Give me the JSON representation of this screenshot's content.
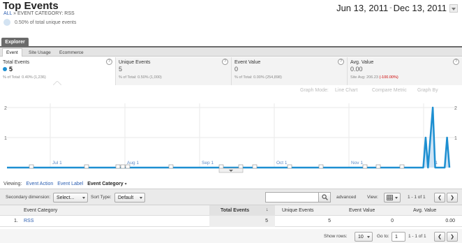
{
  "header": {
    "title": "Top Events",
    "breadcrumb_root": "ALL",
    "breadcrumb_sep": "»",
    "breadcrumb_current": "EVENT CATEGORY: RSS",
    "pct_text": "0.50% of total unique events",
    "date_start": "Jun 13, 2011",
    "date_sep": "-",
    "date_end": "Dec 13, 2011"
  },
  "explorer": {
    "tab_label": "Explorer",
    "subtabs": [
      "Event",
      "Site Usage",
      "Ecommerce"
    ]
  },
  "metrics": [
    {
      "name": "Total Events",
      "value": "5",
      "sub": "% of Total: 0.40% (1,236)",
      "neg": ""
    },
    {
      "name": "Unique Events",
      "value": "5",
      "sub": "% of Total: 0.50% (1,000)",
      "neg": ""
    },
    {
      "name": "Event Value",
      "value": "0",
      "sub": "% of Total: 0.00% (254,898)",
      "neg": ""
    },
    {
      "name": "Avg. Value",
      "value": "0.00",
      "sub": "Site Avg: 206.23 ",
      "neg": "(-100.00%)"
    }
  ],
  "help_glyph": "?",
  "graph_controls": {
    "mode_label": "Graph Mode:",
    "mode_value": "Line Chart",
    "compare": "Compare Metric",
    "graph_by": "Graph By"
  },
  "chart_data": {
    "type": "line",
    "y_ticks": [
      "2",
      "1"
    ],
    "x_labels": [
      "Jul 1",
      "Aug 1",
      "Sep 1",
      "Oct 1",
      "Nov 1",
      "Dec 1"
    ],
    "ylim": [
      0,
      2
    ],
    "series": [
      {
        "values": [
          0,
          0,
          0,
          0,
          0,
          0,
          0,
          0,
          0,
          0,
          0,
          0,
          0,
          0,
          0,
          0,
          0,
          0,
          0,
          0,
          0,
          0,
          0,
          0,
          0,
          0,
          0,
          0,
          0,
          0,
          0,
          0,
          0,
          0,
          0,
          0,
          0,
          0,
          0,
          0,
          0,
          0,
          0,
          0,
          0,
          0,
          0,
          0,
          0,
          0,
          0,
          0,
          0,
          0,
          0,
          0,
          0,
          0,
          0,
          0,
          0,
          0,
          0,
          0,
          0,
          0,
          0,
          0,
          0,
          0,
          0,
          0,
          0,
          0,
          0,
          0,
          0,
          0,
          0,
          0,
          0,
          0,
          0,
          0,
          0,
          0,
          0,
          0,
          0,
          0,
          0,
          0,
          0,
          0,
          0,
          0,
          0,
          0,
          0,
          0,
          0,
          0,
          0,
          0,
          0,
          0,
          0,
          0,
          0,
          0,
          0,
          0,
          0,
          0,
          0,
          0,
          0,
          0,
          0,
          0,
          0,
          0,
          0,
          0,
          0,
          0,
          0,
          0,
          0,
          0,
          0,
          0,
          0,
          0,
          0,
          0,
          0,
          0,
          0,
          0,
          0,
          0,
          0,
          0,
          0,
          0,
          0,
          0,
          0,
          0,
          0,
          0,
          0,
          0,
          0,
          0,
          0,
          0,
          0,
          0,
          0,
          0,
          0,
          0,
          0,
          0,
          0,
          0,
          0,
          0,
          0,
          0,
          0,
          0,
          0,
          0,
          1,
          0,
          1,
          2,
          0,
          0,
          0,
          0,
          0,
          1,
          0
        ]
      }
    ],
    "color": "#1d8fd1"
  },
  "viewing": {
    "label": "Viewing:",
    "options": [
      "Event Action",
      "Event Label",
      "Event Category"
    ]
  },
  "toolbar": {
    "secondary_label": "Secondary dimension:",
    "secondary_value": "Select...",
    "sort_label": "Sort Type:",
    "sort_value": "Default",
    "advanced": "advanced",
    "view_label": "View:",
    "range": "1 - 1 of 1"
  },
  "table": {
    "columns": [
      "Event Category",
      "Total Events",
      "Unique Events",
      "Event Value",
      "Avg. Value"
    ],
    "sort_glyph": "↓",
    "rows": [
      {
        "index": "1.",
        "category": "RSS",
        "total": "5",
        "unique": "5",
        "value": "0",
        "avg": "0.00"
      }
    ]
  },
  "footer": {
    "show_rows_label": "Show rows:",
    "show_rows_value": "10",
    "goto_label": "Go to:",
    "goto_value": "1",
    "range": "1 - 1 of 1"
  }
}
